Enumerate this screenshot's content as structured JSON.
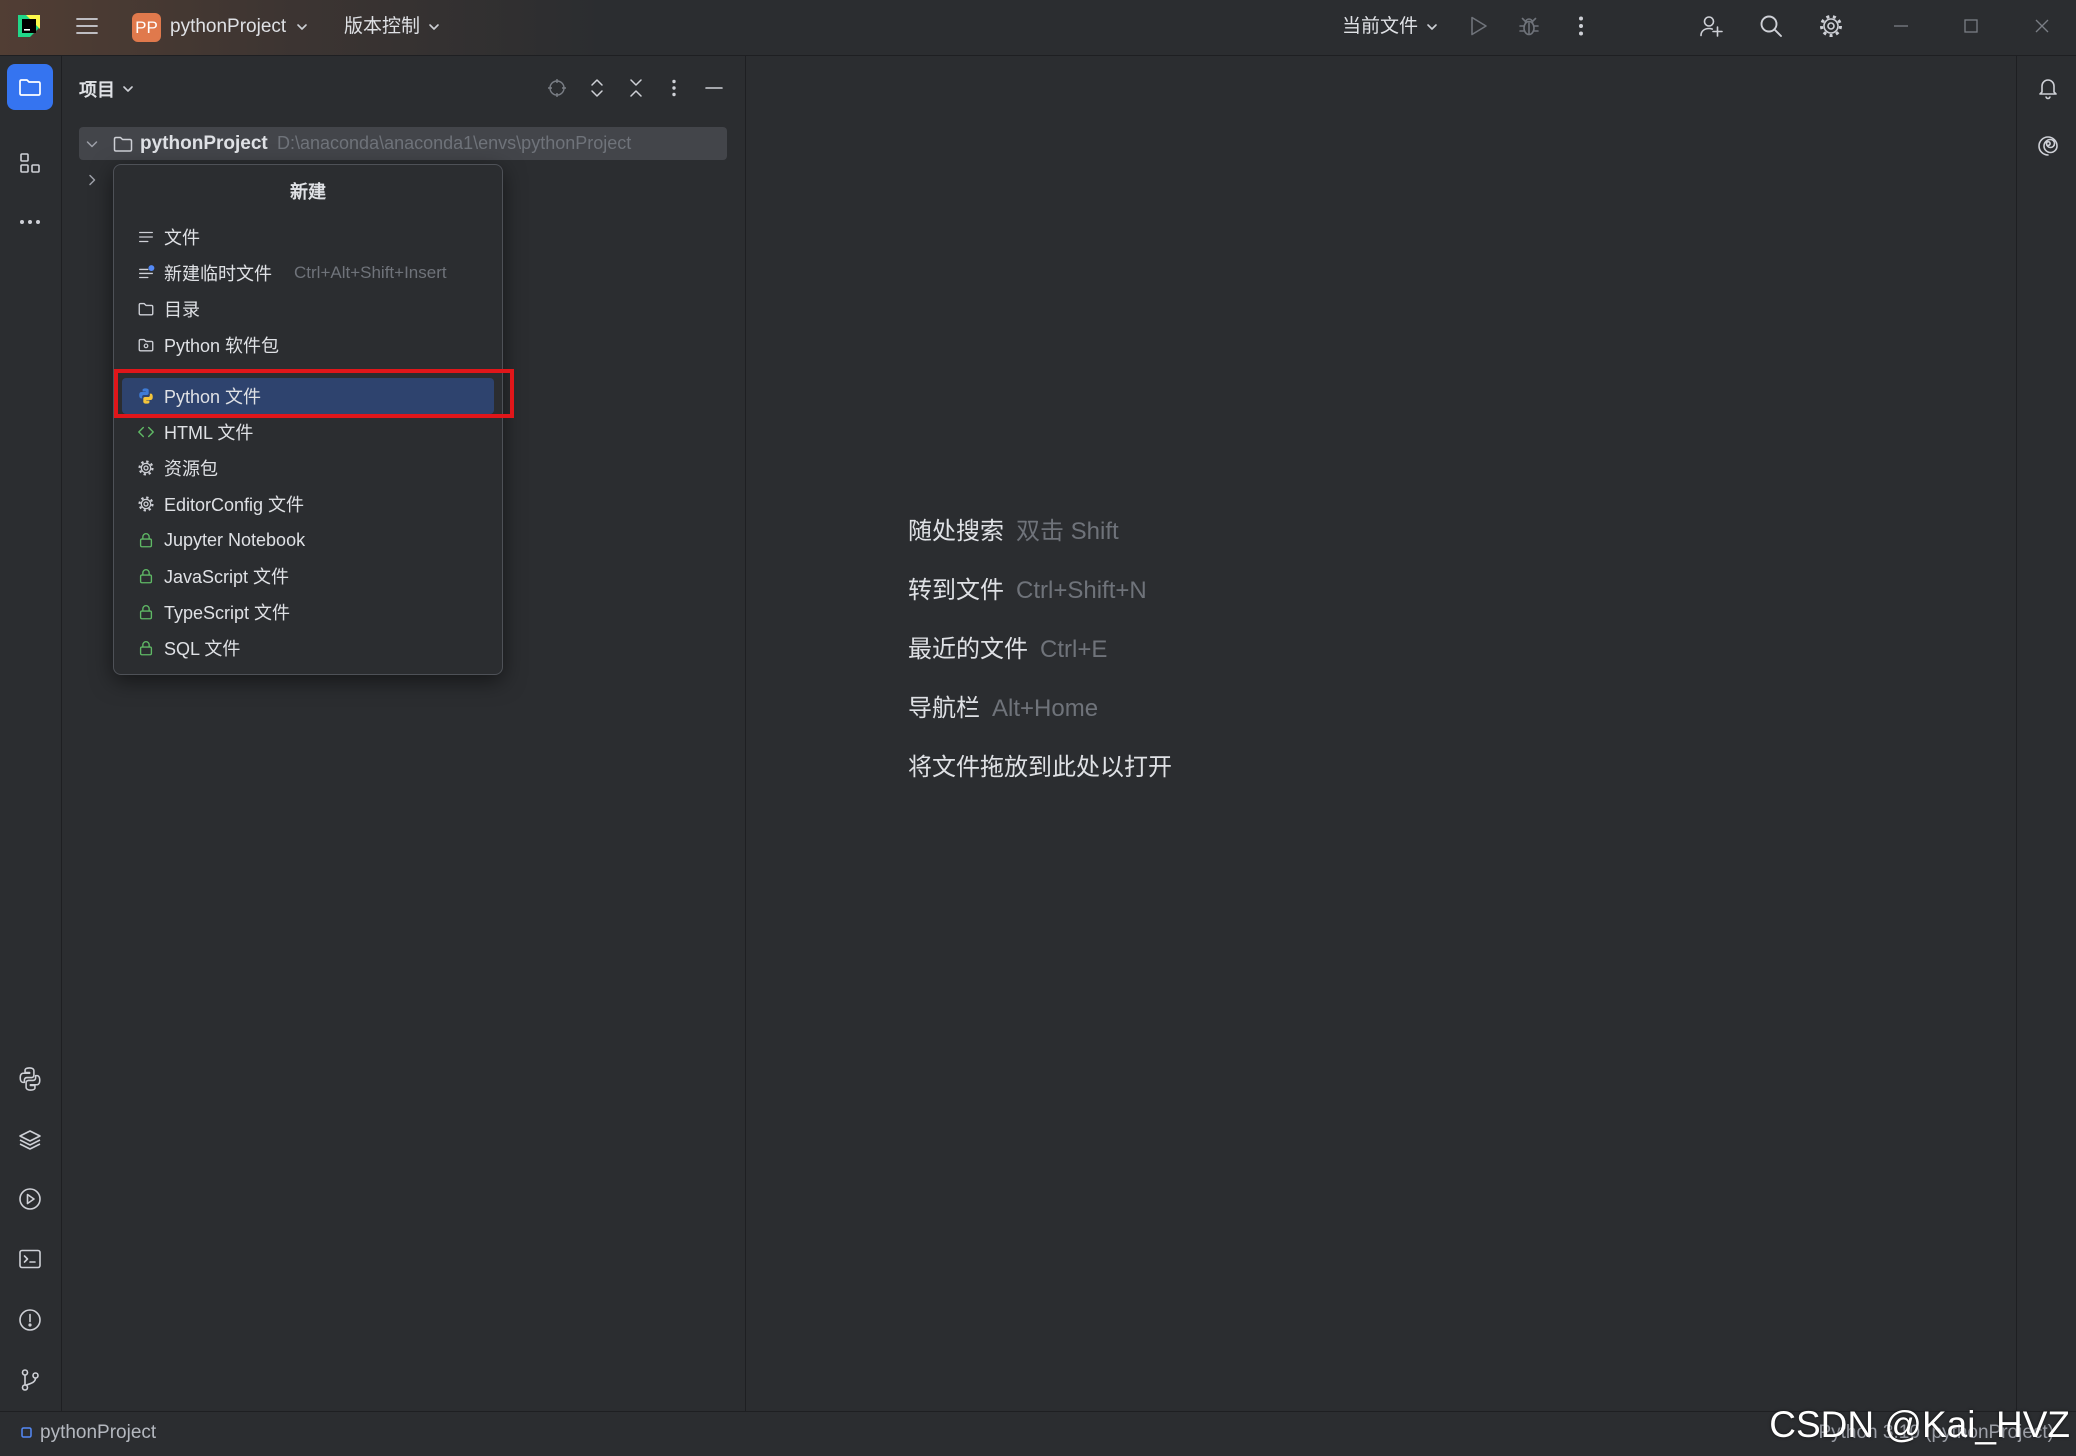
{
  "titlebar": {
    "project_badge": "PP",
    "project_name": "pythonProject",
    "vcs_menu": "版本控制",
    "run_config": "当前文件"
  },
  "project_panel": {
    "title": "项目",
    "root_name": "pythonProject",
    "root_path": "D:\\anaconda\\anaconda1\\envs\\pythonProject"
  },
  "new_menu": {
    "title": "新建",
    "items": [
      {
        "label": "文件",
        "icon": "text-file-icon"
      },
      {
        "label": "新建临时文件",
        "shortcut": "Ctrl+Alt+Shift+Insert",
        "icon": "scratch-file-icon"
      },
      {
        "label": "目录",
        "icon": "folder-icon"
      },
      {
        "label": "Python 软件包",
        "icon": "python-package-icon",
        "separator_after": true
      },
      {
        "label": "Python 文件",
        "icon": "python-file-icon",
        "highlighted": true
      },
      {
        "label": "HTML 文件",
        "icon": "html-icon"
      },
      {
        "label": "资源包",
        "icon": "resource-bundle-icon"
      },
      {
        "label": "EditorConfig 文件",
        "icon": "editorconfig-icon"
      },
      {
        "label": "Jupyter Notebook",
        "icon": "lock-icon"
      },
      {
        "label": "JavaScript 文件",
        "icon": "lock-icon"
      },
      {
        "label": "TypeScript 文件",
        "icon": "lock-icon"
      },
      {
        "label": "SQL 文件",
        "icon": "lock-icon"
      }
    ]
  },
  "editor_hints": [
    {
      "action": "随处搜索",
      "shortcut": "双击 Shift"
    },
    {
      "action": "转到文件",
      "shortcut": "Ctrl+Shift+N"
    },
    {
      "action": "最近的文件",
      "shortcut": "Ctrl+E"
    },
    {
      "action": "导航栏",
      "shortcut": "Alt+Home"
    },
    {
      "action": "将文件拖放到此处以打开"
    }
  ],
  "status_bar": {
    "project": "pythonProject",
    "interpreter": "Python 3.10 (pythonProject)"
  },
  "watermark": "CSDN @Kai_HVZ",
  "colors": {
    "window_bg": "#2b2d30",
    "divider": "#1e1f22",
    "text": "#dfe1e5",
    "muted": "#6f737a",
    "accent": "#3574f0",
    "menu_selection": "#2e436e",
    "inactive_selection": "#43454a",
    "project_badge": "#e0794c",
    "annotation_red": "#e0161a"
  }
}
